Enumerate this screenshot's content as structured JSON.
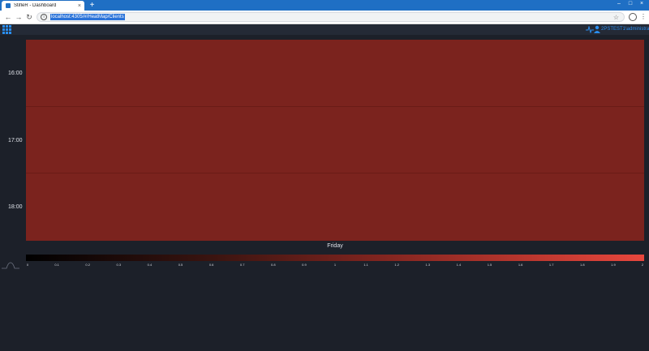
{
  "browser": {
    "tab_title": "StifleR - Dashboard",
    "tab_close": "×",
    "new_tab": "+",
    "url": "localhost:4305/#/HeatMap/Clients",
    "minimize": "–",
    "maximize": "□",
    "close": "×"
  },
  "app": {
    "user": "2PSTEST1\\administrator"
  },
  "heatmap": {
    "y_labels": [
      "16:00",
      "17:00",
      "18:00"
    ],
    "x_label": "Friday",
    "fill_color": "#7b231e"
  },
  "colorbar": {
    "ticks": [
      "0",
      "0.1",
      "0.2",
      "0.3",
      "0.4",
      "0.5",
      "0.6",
      "0.7",
      "0.8",
      "0.9",
      "1",
      "1.1",
      "1.2",
      "1.3",
      "1.4",
      "1.5",
      "1.6",
      "1.7",
      "1.8",
      "1.9",
      "2"
    ],
    "min_color": "#000000",
    "max_color": "#e8473d"
  },
  "chart_data": {
    "type": "heatmap",
    "rows": [
      "16:00",
      "17:00",
      "18:00"
    ],
    "columns": [
      "Friday"
    ],
    "values": [
      [
        1.0
      ],
      [
        1.0
      ],
      [
        1.0
      ]
    ],
    "colorbar_range": [
      0,
      2
    ]
  }
}
